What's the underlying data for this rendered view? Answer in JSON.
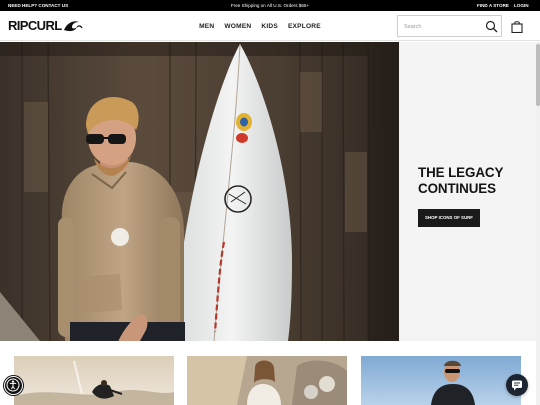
{
  "topbar": {
    "help": "NEED HELP? CONTACT US",
    "shipping": "Free Shipping on All U.S. Orders $65+",
    "store": "FIND A STORE",
    "login": "LOGIN"
  },
  "header": {
    "logo_text": "RIPCURL",
    "nav": [
      "MEN",
      "WOMEN",
      "KIDS",
      "EXPLORE"
    ],
    "search": {
      "placeholder": "Search",
      "value": ""
    }
  },
  "hero": {
    "title": "THE LEGACY\nCONTINUES",
    "cta": "SHOP ICONS OF SURF"
  },
  "colors": {
    "topbar_bg": "#000000",
    "cta_bg": "#1a1a1a",
    "hero_panel_bg": "#f4f4f4",
    "chat_bg": "#1b2430"
  },
  "icons": [
    "logo-wave-icon",
    "search-icon",
    "shopping-bag-icon",
    "accessibility-icon",
    "chat-icon"
  ]
}
